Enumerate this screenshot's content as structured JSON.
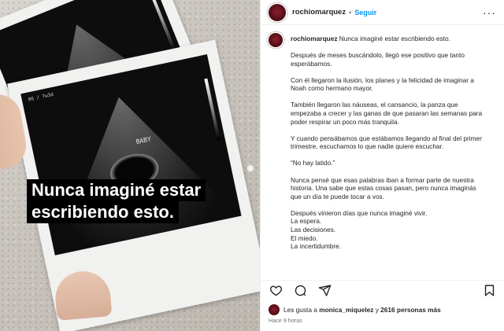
{
  "media": {
    "overlay_lines": [
      "Nunca imaginé estar",
      "escribiendo esto."
    ],
    "scan_labels": {
      "baby": "BABY",
      "gestational_age": "06 / 7w3d"
    }
  },
  "header": {
    "username": "rochiomarquez",
    "separator": "•",
    "follow_label": "Seguir",
    "more_label": "···"
  },
  "caption": {
    "username": "rochiomarquez",
    "first_line": "Nunca imaginé estar escribiendo esto.",
    "paragraphs": [
      "Después de meses buscándolo, llegó ese positivo que tanto esperábamos.",
      "Con él llegaron la ilusión, los planes y la felicidad de imaginar a Noah como hermano mayor.",
      "También llegaron las náuseas, el cansancio, la panza que empezaba a crecer y las ganas de que pasaran las semanas para poder respirar un poco más tranquila.",
      "Y cuando pensábamos que estábamos llegando al final del primer trimestre, escuchamos lo que nadie quiere escuchar.",
      "“No hay latido.”",
      "Nunca pensé que esas palabras iban a formar parte de nuestra historia. Una sabe que estas cosas pasan, pero nunca imaginás que un día te puede tocar a vos.",
      "Después vinieron días que nunca imaginé vivir."
    ],
    "list_lines": [
      "La espera.",
      "Las decisiones.",
      "El miedo.",
      "La incertidumbre."
    ]
  },
  "actions": {
    "like_icon": "heart-icon",
    "comment_icon": "comment-icon",
    "share_icon": "share-icon",
    "save_icon": "bookmark-icon"
  },
  "likes": {
    "prefix": "Les gusta a",
    "user": "monica_miquelez",
    "middle": "y",
    "count": "2616 personas más"
  },
  "timestamp": "Hace 9 horas",
  "colors": {
    "accent": "#0095f6",
    "text": "#262626",
    "muted": "#737373"
  }
}
